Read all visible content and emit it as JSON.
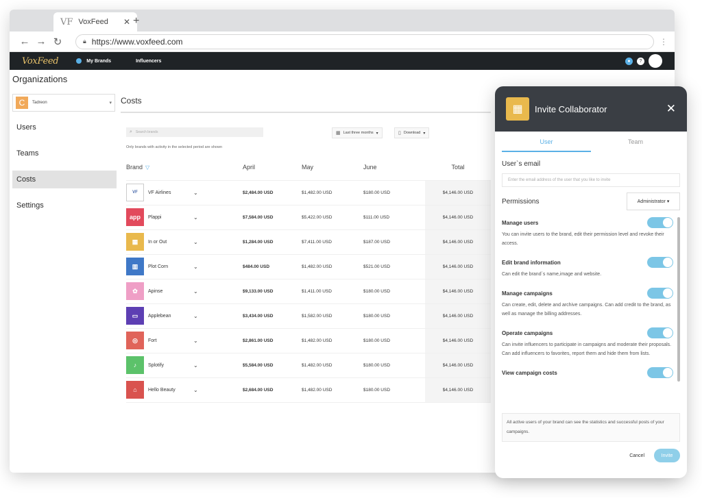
{
  "browser": {
    "tab_title": "VoxFeed",
    "tab_favicon": "VF",
    "url": "https://www.voxfeed.com"
  },
  "appnav": {
    "logo": "VoxFeed",
    "items": [
      {
        "label": "My Brands"
      },
      {
        "label": "Influencers"
      }
    ]
  },
  "sidebar": {
    "title": "Organizations",
    "org": {
      "initial": "C",
      "name": "Tadreon"
    },
    "items": [
      {
        "label": "Users"
      },
      {
        "label": "Teams"
      },
      {
        "label": "Costs"
      },
      {
        "label": "Settings"
      }
    ]
  },
  "costs": {
    "title": "Costs",
    "search_placeholder": "Search brands",
    "hint": "Only brands with activity in the selected period are shown",
    "range_label": "Last three months",
    "download_label": "Download",
    "columns": [
      "Brand",
      "April",
      "May",
      "June",
      "Total"
    ],
    "rows": [
      {
        "brand": "VF Airlines",
        "logo_text": "VF",
        "color": "#ffffff",
        "april": "$2,484.00 USD",
        "may": "$1,482.00 USD",
        "june": "$180.00 USD",
        "total": "$4,146.00 USD"
      },
      {
        "brand": "Plappi",
        "logo_text": "app",
        "color": "#e24a5c",
        "april": "$7,584.00 USD",
        "may": "$5,422.00 USD",
        "june": "$111.00 USD",
        "total": "$4,146.00 USD"
      },
      {
        "brand": "In or Out",
        "logo_text": "▦",
        "color": "#e9b94d",
        "april": "$1,284.00 USD",
        "may": "$7,411.00 USD",
        "june": "$187.00 USD",
        "total": "$4,146.00 USD"
      },
      {
        "brand": "Plot Corn",
        "logo_text": "▥",
        "color": "#3f78c7",
        "april": "$484.00 USD",
        "may": "$1,482.00 USD",
        "june": "$521.00 USD",
        "total": "$4,146.00 USD"
      },
      {
        "brand": "Apinse",
        "logo_text": "✿",
        "color": "#ef9fc6",
        "april": "$9,133.00 USD",
        "may": "$1,411.00 USD",
        "june": "$180.00 USD",
        "total": "$4,146.00 USD"
      },
      {
        "brand": "Applebean",
        "logo_text": "▭",
        "color": "#5d3fb3",
        "april": "$3,434.00 USD",
        "may": "$1,582.00 USD",
        "june": "$180.00 USD",
        "total": "$4,146.00 USD"
      },
      {
        "brand": "Fort",
        "logo_text": "◎",
        "color": "#e0645a",
        "april": "$2,861.00 USD",
        "may": "$1,482.00 USD",
        "june": "$180.00 USD",
        "total": "$4,146.00 USD"
      },
      {
        "brand": "Splotify",
        "logo_text": "♪",
        "color": "#5cc26a",
        "april": "$5,584.00 USD",
        "may": "$1,482.00 USD",
        "june": "$180.00 USD",
        "total": "$4,146.00 USD"
      },
      {
        "brand": "Hello Beauty",
        "logo_text": "⌂",
        "color": "#d9534f",
        "april": "$2,684.00 USD",
        "may": "$1,482.00 USD",
        "june": "$180.00 USD",
        "total": "$4,146.00 USD"
      }
    ]
  },
  "invite": {
    "title": "Invite Collaborator",
    "tabs": [
      {
        "label": "User"
      },
      {
        "label": "Team"
      }
    ],
    "email_label": "User`s email",
    "email_placeholder": "Enter the email address of the user that you like to invite",
    "permissions_label": "Permissions",
    "role": "Administrator",
    "permissions": [
      {
        "name": "Manage users",
        "desc": "You can invite users to the brand, edit their permission level and revoke their access."
      },
      {
        "name": "Edit brand information",
        "desc": "Can edit the brand´s name,image and website."
      },
      {
        "name": "Manage campaigns",
        "desc": "Can create, edit, delete and archive campaigns. Can add credit to the brand, as well as manage the billing addresses."
      },
      {
        "name": "Operate campaigns",
        "desc": "Can invite influencers to participate in campaigns and moderate their proposals. Can add influencers to favorites, report them and hide them from lists."
      },
      {
        "name": "View campaign costs",
        "desc": ""
      }
    ],
    "note": "All active users of your brand can see the statistics and successful posts of your campaigns.",
    "cancel_label": "Cancel",
    "invite_label": "Invite"
  }
}
